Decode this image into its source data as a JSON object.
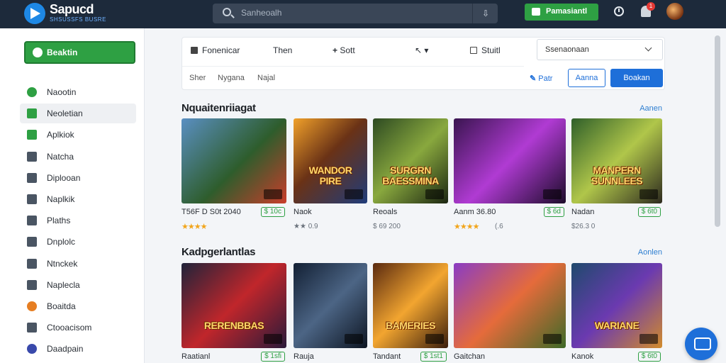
{
  "app": {
    "brand": "Sapucd",
    "brand_sub": "SHSUSSFS BUSRE"
  },
  "header": {
    "search_placeholder": "Sanheoalh",
    "premium_label": "Pamasiantl",
    "notification_count": "1"
  },
  "sidebar": {
    "cta_label": "Beaktin",
    "items": [
      {
        "label": "Naootin",
        "icon": "check-circle-icon",
        "color": "#2ea043"
      },
      {
        "label": "Neoletian",
        "icon": "news-icon",
        "color": "#2ea043"
      },
      {
        "label": "Aplkiok",
        "icon": "app-icon",
        "color": "#2ea043"
      },
      {
        "label": "Natcha",
        "icon": "edit-icon",
        "color": "#4a5563"
      },
      {
        "label": "Diplooan",
        "icon": "store-icon",
        "color": "#4a5563"
      },
      {
        "label": "Naplkik",
        "icon": "tag-icon",
        "color": "#4a5563"
      },
      {
        "label": "Plaths",
        "icon": "window-icon",
        "color": "#4a5563"
      },
      {
        "label": "Dnplolc",
        "icon": "list-icon",
        "color": "#4a5563"
      },
      {
        "label": "Ntnckek",
        "icon": "user-icon",
        "color": "#4a5563"
      },
      {
        "label": "Naplecla",
        "icon": "doc-icon",
        "color": "#4a5563"
      },
      {
        "label": "Boaitda",
        "icon": "gift-icon",
        "color": "#e67e22"
      },
      {
        "label": "Ctooacisom",
        "icon": "pencil-icon",
        "color": "#4a5563"
      },
      {
        "label": "Daadpain",
        "icon": "globe-icon",
        "color": "#3949ab"
      }
    ]
  },
  "filters": {
    "row1": [
      "Fonenicar",
      "Then",
      "Sott",
      "",
      "Stuitl"
    ],
    "select_value": "Ssenaonaan",
    "tags": [
      "Sher",
      "Nygana",
      "Najal"
    ],
    "link_label": "Patr",
    "outline_label": "Aanna",
    "primary_label": "Boakan"
  },
  "sections": [
    {
      "title": "Nquaitenriiagat",
      "link": "Aanen",
      "cards": [
        {
          "name": "T56F D S0t 2040",
          "price": "$ 10c",
          "stars": "★★★★",
          "sub": "",
          "title": "",
          "bg": "linear-gradient(135deg,#5a8fc2,#2e5d2c 55%,#c93d2b)"
        },
        {
          "name": "Naok",
          "price": "",
          "stars": "",
          "sub": "★★ 0.9",
          "title": "WANDOR PIRE",
          "bg": "linear-gradient(135deg,#f0a02a,#6a3216 45%,#1f3c7a)"
        },
        {
          "name": "Reoals",
          "price": "",
          "stars": "",
          "sub": "$ 69 200",
          "title": "SURGRN BAESSMINA",
          "bg": "linear-gradient(135deg,#2d4a22,#89a83e 50%,#1b2612)"
        },
        {
          "name": "Aanm 36.80",
          "price": "$ 6d",
          "stars": "★★★★",
          "sub": "(.6",
          "title": "",
          "bg": "linear-gradient(135deg,#3a1550,#b03bd3 50%,#1c0c2a)"
        },
        {
          "name": "Nadan",
          "price": "$ 6t0",
          "stars": "",
          "sub": "$26.3 0",
          "title": "MANPERN SUNNLEES",
          "bg": "linear-gradient(135deg,#2f5f2a,#b0c64a 50%,#2d2a1f)"
        }
      ]
    },
    {
      "title": "Kadpgerlantlas",
      "link": "Aonlen",
      "cards": [
        {
          "name": "Raatianl",
          "price": "$ 1sfi",
          "stars": "",
          "sub": "",
          "title": "RERENBBAS",
          "bg": "linear-gradient(135deg,#20233a,#c0262b 50%,#2a1a3a)"
        },
        {
          "name": "Rauja",
          "price": "",
          "stars": "",
          "sub": "",
          "title": "",
          "bg": "linear-gradient(135deg,#132034,#4c6585 50%,#0d1522)"
        },
        {
          "name": "Tandant",
          "price": "$ 1st1",
          "stars": "",
          "sub": "",
          "title": "BAMERIES",
          "bg": "linear-gradient(135deg,#5a2a10,#f2a530 50%,#3a1d0c)"
        },
        {
          "name": "Gaitchan",
          "price": "",
          "stars": "",
          "sub": "",
          "title": "",
          "bg": "linear-gradient(135deg,#8a3cc4,#e56b3b 50%,#3d6a28)"
        },
        {
          "name": "Kanok",
          "price": "$ 6t0",
          "stars": "",
          "sub": "",
          "title": "WARIANE",
          "bg": "linear-gradient(135deg,#1f4a6d,#6b3ab0 50%,#d18b2b)"
        }
      ]
    }
  ]
}
